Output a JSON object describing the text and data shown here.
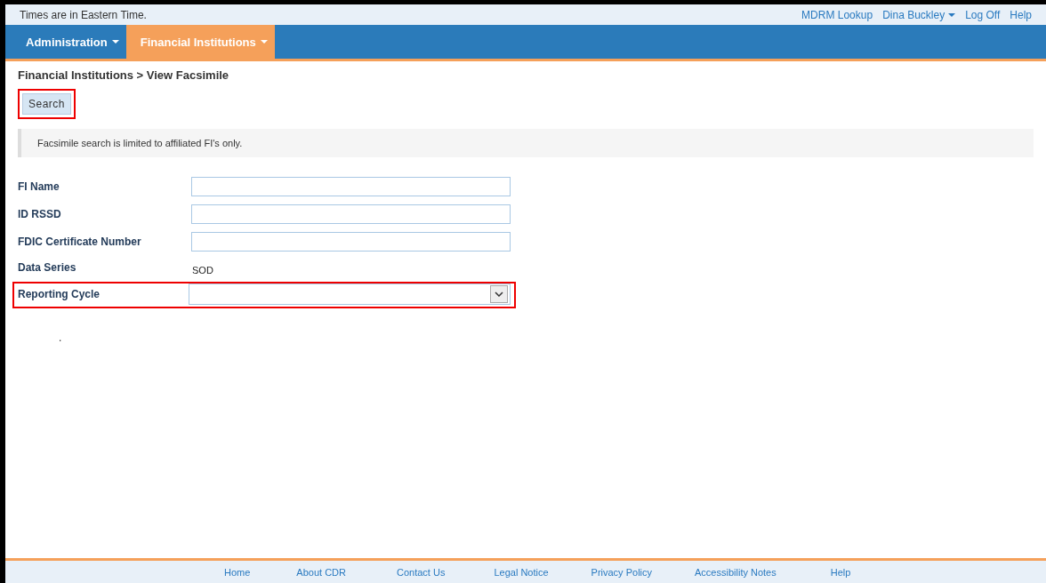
{
  "top_bar": {
    "notice": "Times are in Eastern Time.",
    "links": [
      {
        "label": "MDRM Lookup"
      },
      {
        "label": "Dina Buckley",
        "dropdown": true
      },
      {
        "label": "Log Off"
      },
      {
        "label": "Help"
      }
    ]
  },
  "nav": [
    {
      "label": "Administration",
      "selected": false
    },
    {
      "label": "Financial Institutions",
      "selected": true
    }
  ],
  "breadcrumb": "Financial Institutions > View Facsimile",
  "search_button": {
    "label": "Search",
    "highlighted": true
  },
  "info": "Facsimile search is limited to affiliated FI's only.",
  "form": [
    {
      "kind": "text",
      "label": "FI Name"
    },
    {
      "kind": "text",
      "label": "ID RSSD"
    },
    {
      "kind": "text",
      "label": "FDIC Certificate Number"
    },
    {
      "kind": "static",
      "label": "Data Series",
      "value": "SOD"
    },
    {
      "kind": "select",
      "label": "Reporting Cycle",
      "highlighted": true
    }
  ],
  "stray_mark": ".",
  "footer": [
    "Home",
    "About CDR",
    "Contact Us",
    "Legal Notice",
    "Privacy Policy",
    "Accessibility Notes",
    "Help"
  ]
}
